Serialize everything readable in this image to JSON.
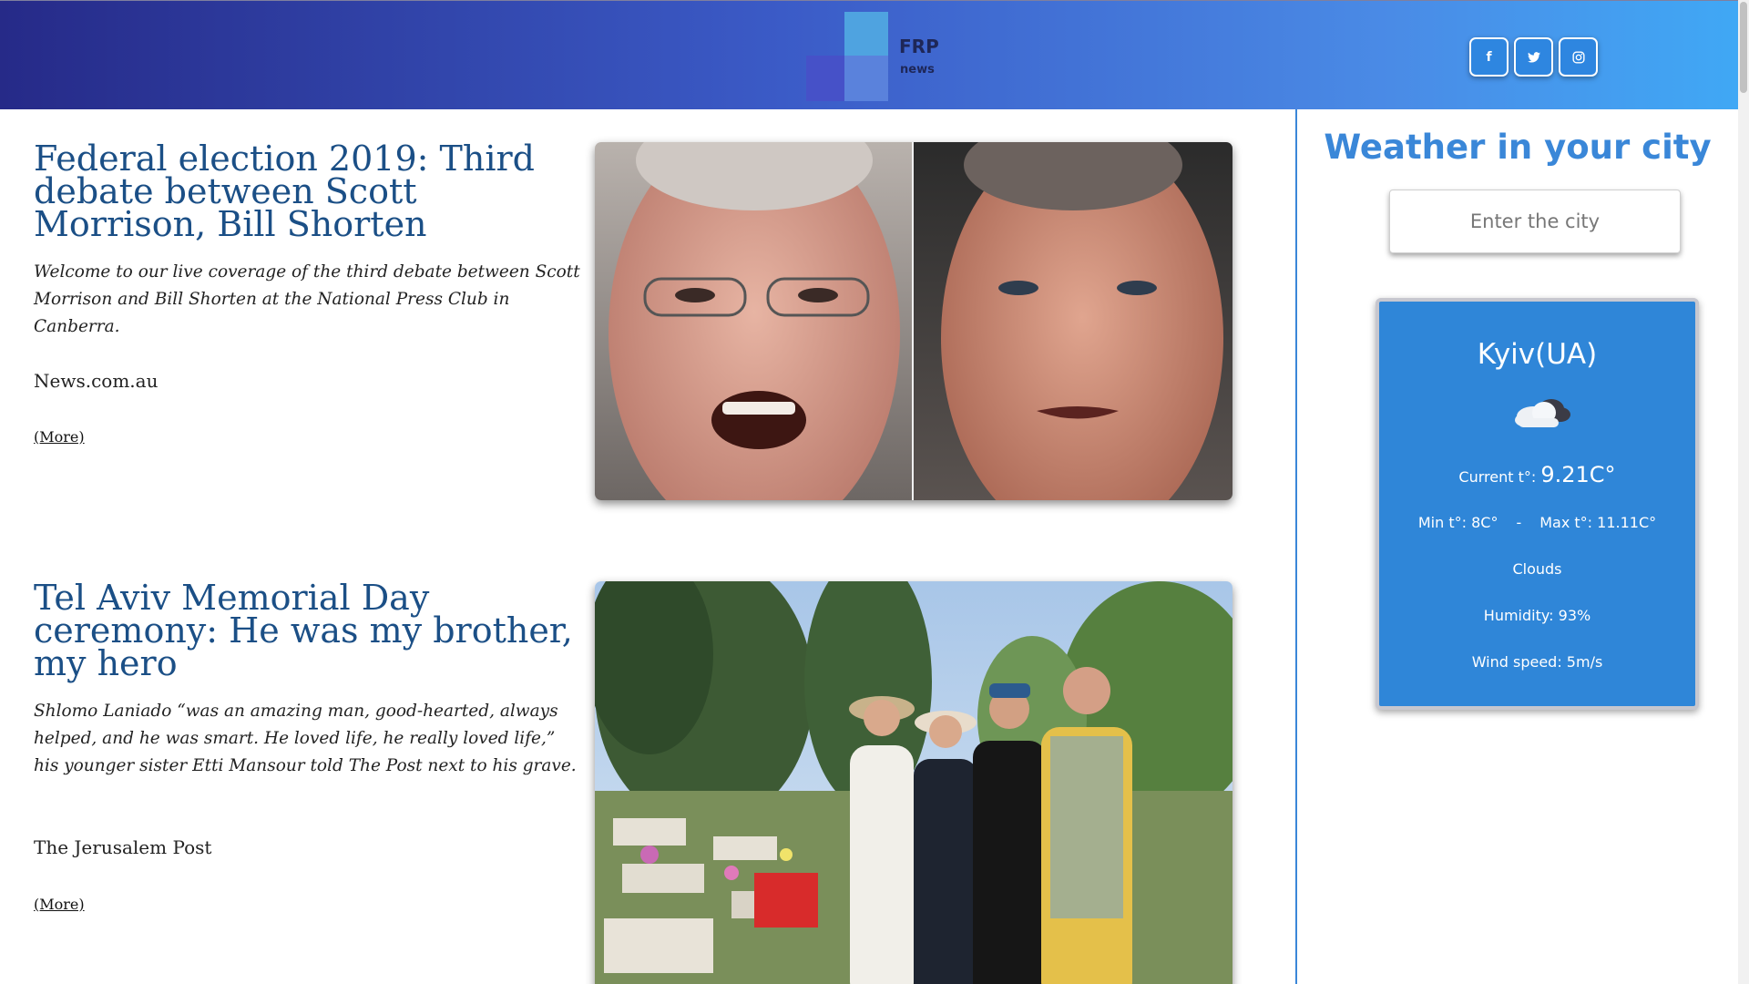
{
  "header": {
    "logo_text": "FRP",
    "logo_sub": "news",
    "social": [
      {
        "icon": "facebook-icon",
        "glyph": "f"
      },
      {
        "icon": "twitter-icon",
        "glyph": "t"
      },
      {
        "icon": "instagram-icon",
        "glyph": "◎"
      }
    ]
  },
  "articles": [
    {
      "title": "Federal election 2019: Third debate between Scott Morrison, Bill Shorten",
      "description": "Welcome to our live coverage of the third debate between Scott Morrison and Bill Shorten at the National Press Club in Canberra.",
      "source": "News.com.au",
      "more": "(More)"
    },
    {
      "title": "Tel Aviv Memorial Day ceremony: He was my brother, my hero",
      "description": "Shlomo Laniado “was an amazing man, good-hearted, always helped, and he was smart. He loved life, he really loved life,” his younger sister Etti Mansour told The Post next to his grave.",
      "source": "The Jerusalem Post",
      "more": "(More)"
    }
  ],
  "weather": {
    "title": "Weather in your city",
    "input_placeholder": "Enter the city",
    "city": "Kyiv(UA)",
    "icon": "cloud-icon",
    "current_label": "Current t°: ",
    "current_value": "9.21C°",
    "min": "Min t°: 8C°",
    "separator": "-",
    "max": "Max t°: 11.11C°",
    "description": "Clouds",
    "humidity": "Humidity: 93%",
    "wind": "Wind speed: 5m/s"
  }
}
